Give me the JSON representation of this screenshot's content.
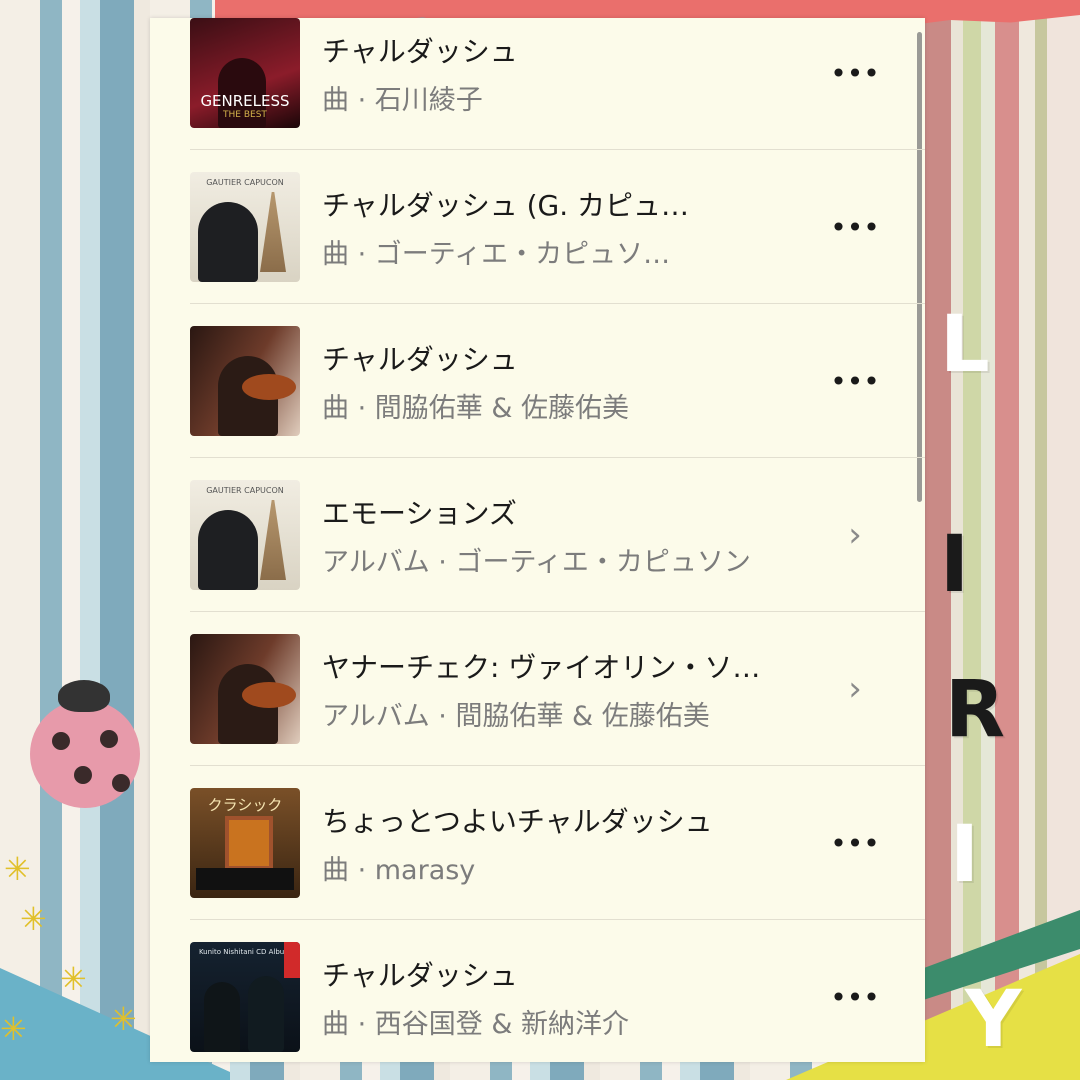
{
  "decoration": {
    "letters": [
      "L",
      "I",
      "R",
      "I",
      "Y"
    ]
  },
  "results": [
    {
      "title": "チャルダッシュ",
      "subtitle": "曲 · 石川綾子",
      "art": "genreless",
      "art_text": "GENRELESS",
      "art_subtext": "THE BEST",
      "action": "more-icon",
      "action_glyph": "•••"
    },
    {
      "title": "チャルダッシュ (G. カピュ…",
      "subtitle": "曲 · ゴーティエ・カピュソ…",
      "art": "capucon",
      "art_text": "GAUTIER CAPUCON",
      "action": "more-icon",
      "action_glyph": "•••"
    },
    {
      "title": "チャルダッシュ",
      "subtitle": "曲 · 間脇佑華 & 佐藤佑美",
      "art": "mawaki",
      "action": "more-icon",
      "action_glyph": "•••"
    },
    {
      "title": "エモーションズ",
      "subtitle": "アルバム · ゴーティエ・カピュソン",
      "art": "capucon",
      "art_text": "GAUTIER CAPUCON",
      "action": "chevron-right-icon",
      "action_glyph": "›"
    },
    {
      "title": "ヤナーチェク: ヴァイオリン・ソ…",
      "subtitle": "アルバム · 間脇佑華 & 佐藤佑美",
      "art": "mawaki",
      "action": "chevron-right-icon",
      "action_glyph": "›"
    },
    {
      "title": "ちょっとつよいチャルダッシュ",
      "subtitle": "曲 · marasy",
      "art": "classic",
      "art_text": "クラシック",
      "action": "more-icon",
      "action_glyph": "•••"
    },
    {
      "title": "チャルダッシュ",
      "subtitle": "曲 · 西谷国登 & 新納洋介",
      "art": "nishitani",
      "art_text": "Kunito Nishitani CD Album",
      "action": "more-icon",
      "action_glyph": "•••"
    }
  ]
}
